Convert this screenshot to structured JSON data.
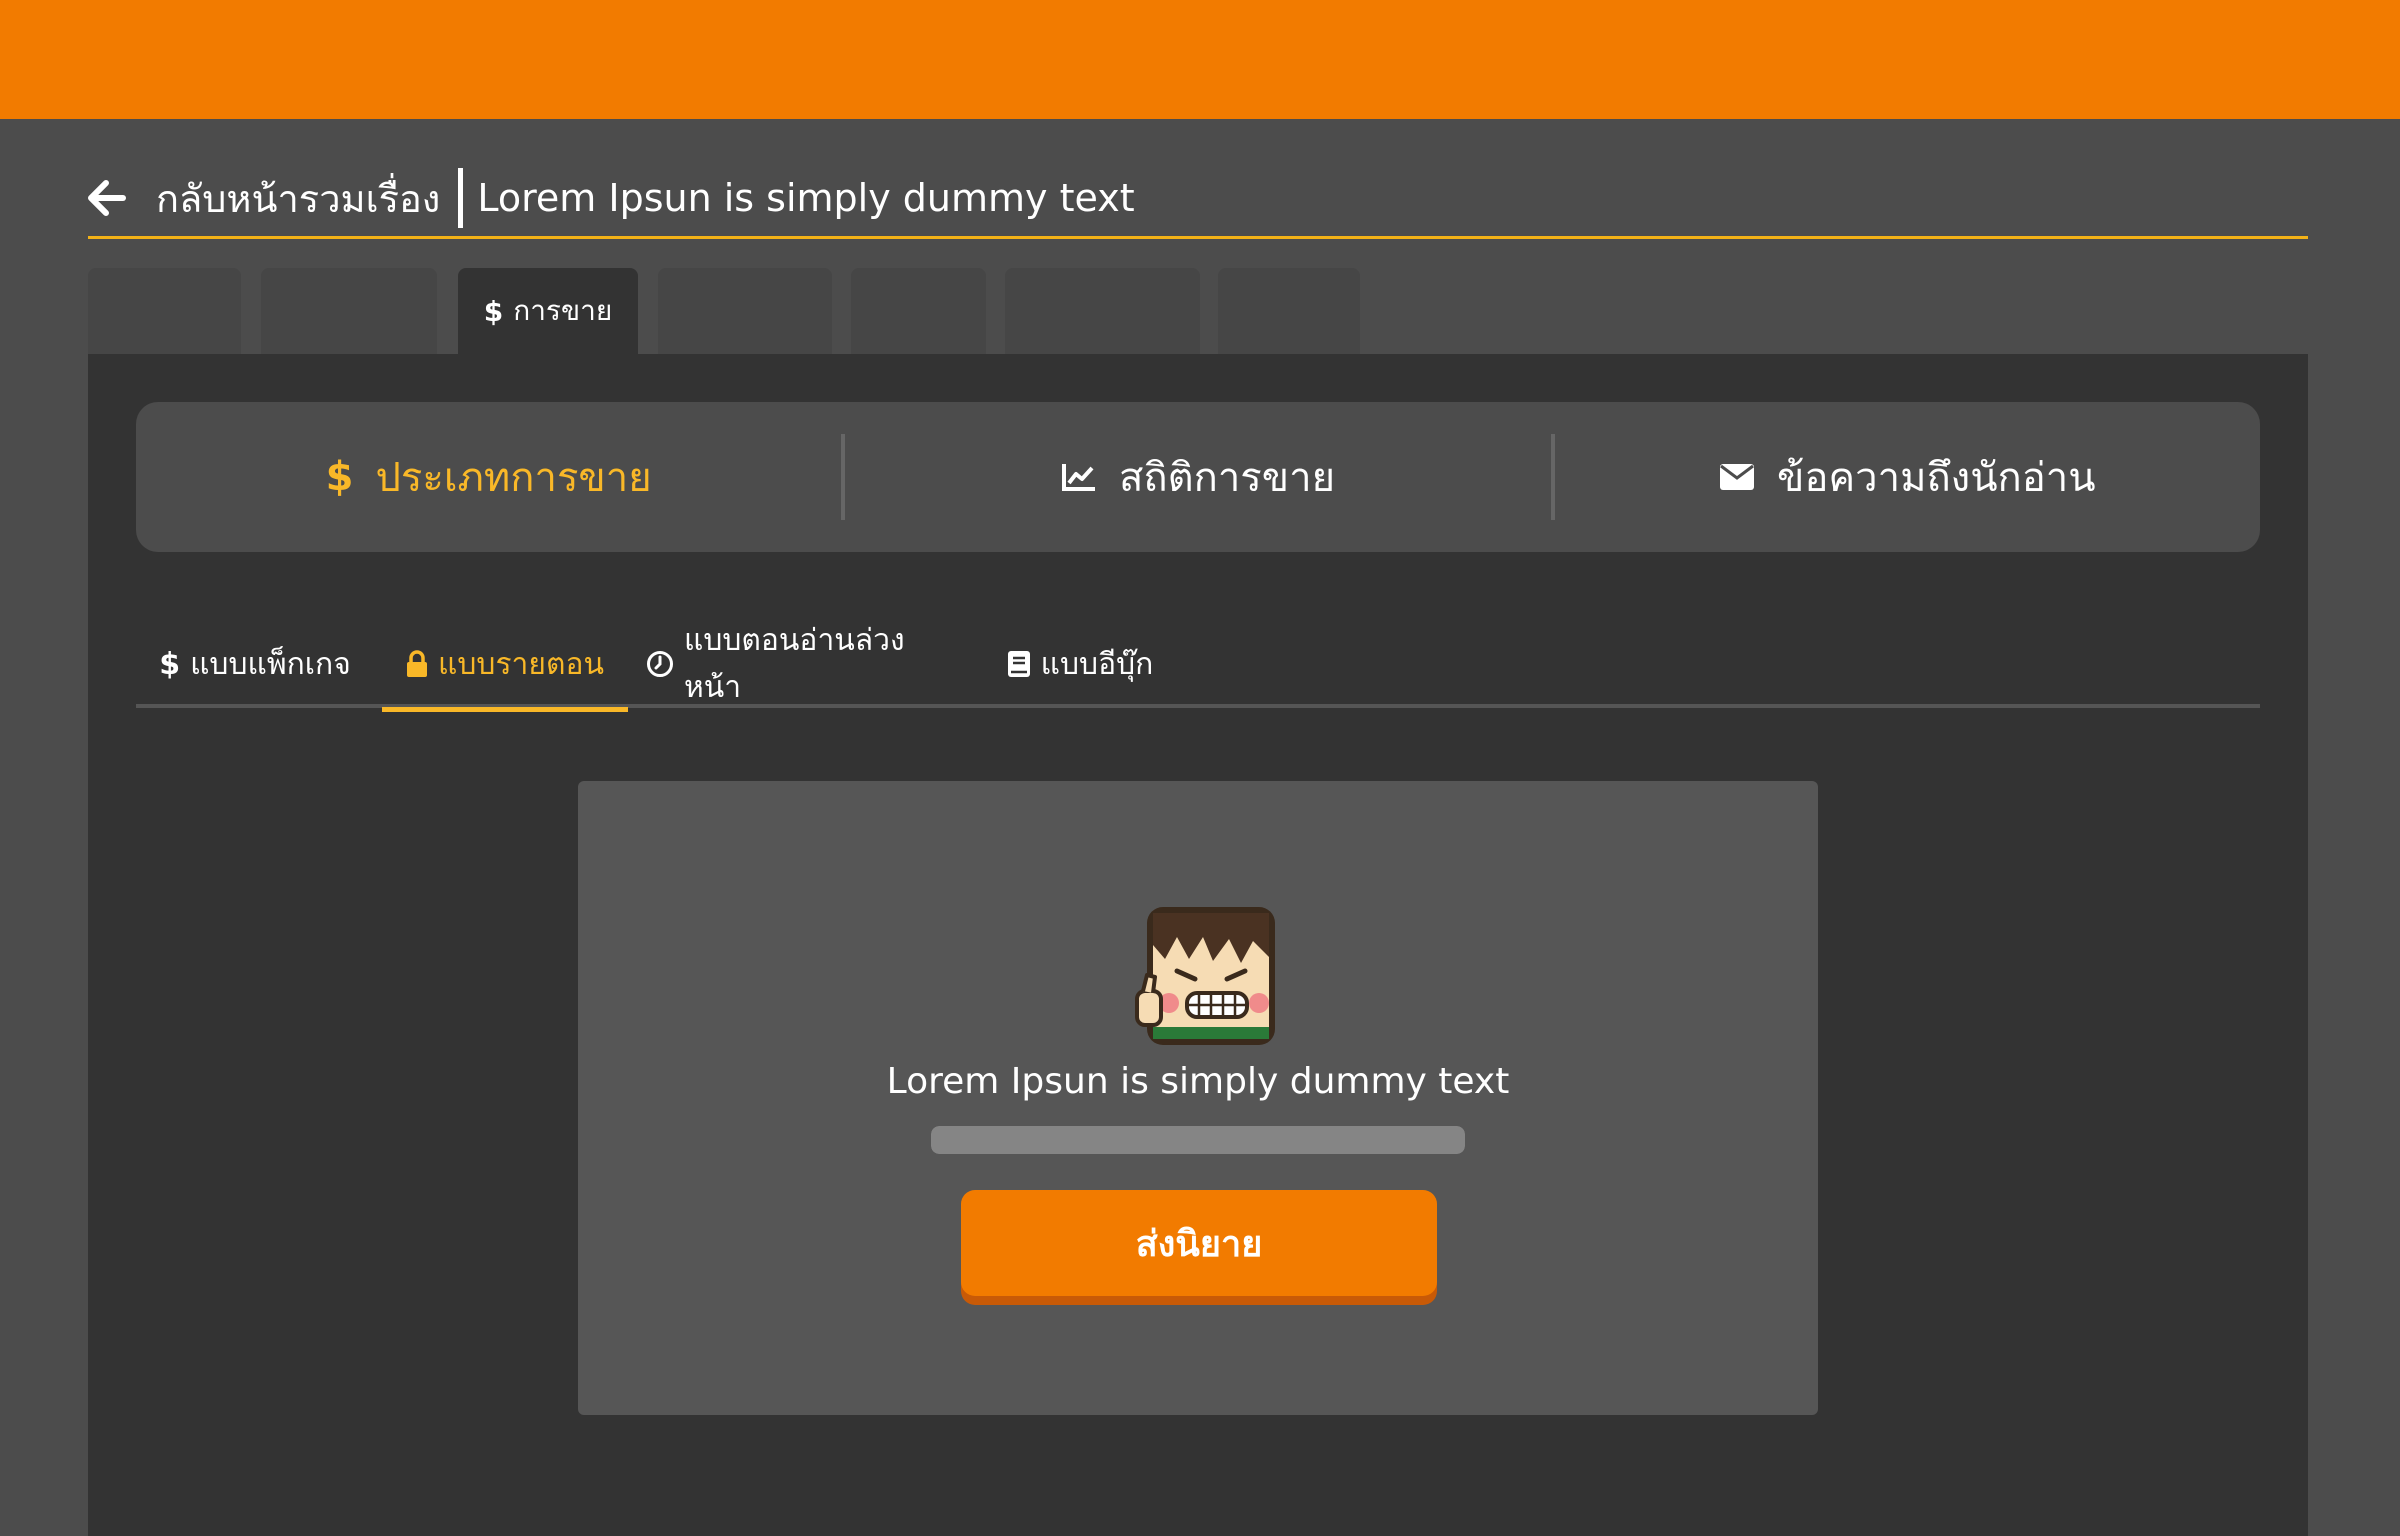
{
  "header": {
    "back_label": "กลับหน้ารวมเรื่อง",
    "story_title": "Lorem Ipsun is simply dummy text"
  },
  "tabs": [
    {
      "label": "",
      "icon": "",
      "active": false
    },
    {
      "label": "",
      "icon": "",
      "active": false
    },
    {
      "label": "การขาย",
      "icon": "dollar-icon",
      "active": true
    },
    {
      "label": "",
      "icon": "",
      "active": false
    },
    {
      "label": "",
      "icon": "",
      "active": false
    },
    {
      "label": "",
      "icon": "",
      "active": false
    },
    {
      "label": "",
      "icon": "",
      "active": false
    }
  ],
  "segments": [
    {
      "label": "ประเภทการขาย",
      "icon": "dollar-icon",
      "active": true
    },
    {
      "label": "สถิติการขาย",
      "icon": "line-chart-icon",
      "active": false
    },
    {
      "label": "ข้อความถึงนักอ่าน",
      "icon": "envelope-icon",
      "active": false
    }
  ],
  "subtabs": [
    {
      "label": "แบบแพ็กเกจ",
      "icon": "dollar-icon",
      "active": false
    },
    {
      "label": "แบบรายตอน",
      "icon": "lock-icon",
      "active": true
    },
    {
      "label": "แบบตอนอ่านล่วงหน้า",
      "icon": "clock-icon",
      "active": false
    },
    {
      "label": "แบบอีบุ๊ก",
      "icon": "book-icon",
      "active": false
    }
  ],
  "card": {
    "mascot": "mascot-icon",
    "text": "Lorem Ipsun is simply dummy text",
    "progress": 1.0,
    "button_label": "ส่งนิยาย"
  },
  "colors": {
    "brand_orange": "#f27b00",
    "accent_yellow": "#f9b828",
    "background": "#4c4c4c",
    "panel": "#333333"
  }
}
